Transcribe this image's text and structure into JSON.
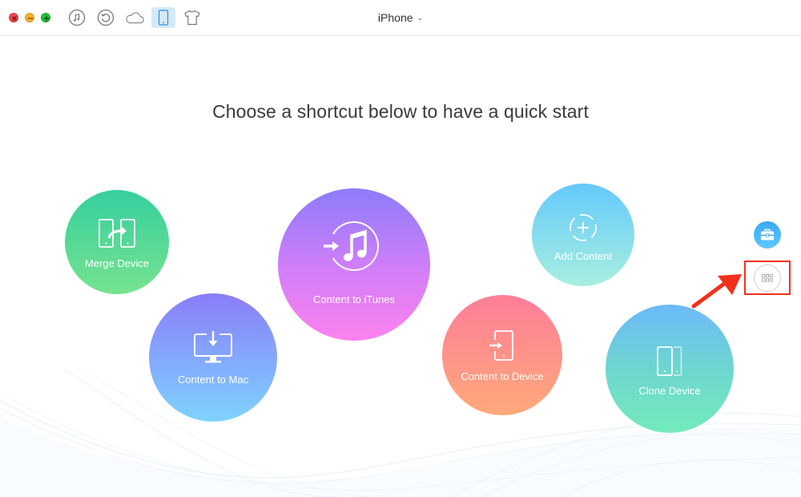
{
  "window": {
    "controls": [
      "close",
      "minimize",
      "maximize"
    ],
    "toolbar": [
      {
        "name": "itunes-library",
        "icon": "music-note-icon",
        "active": false
      },
      {
        "name": "backup-restore",
        "icon": "restore-icon",
        "active": false
      },
      {
        "name": "icloud",
        "icon": "cloud-icon",
        "active": false
      },
      {
        "name": "device",
        "icon": "phone-icon",
        "active": true
      },
      {
        "name": "extras",
        "icon": "tshirt-icon",
        "active": false
      }
    ],
    "device_selector": {
      "label": "iPhone",
      "icon": "chevron-down-icon"
    }
  },
  "main": {
    "headline": "Choose a shortcut below to have a quick start",
    "shortcuts": [
      {
        "id": "merge-device",
        "label": "Merge Device",
        "icon": "merge-device-icon",
        "colors": [
          "#36cf9f",
          "#76e38f"
        ]
      },
      {
        "id": "content-to-mac",
        "label": "Content to Mac",
        "icon": "monitor-download-icon",
        "colors": [
          "#8a7df9",
          "#7ed3ff"
        ]
      },
      {
        "id": "content-to-itunes",
        "label": "Content to iTunes",
        "icon": "itunes-transfer-icon",
        "colors": [
          "#8c7cfb",
          "#fb82ee"
        ]
      },
      {
        "id": "content-to-device",
        "label": "Content to Device",
        "icon": "device-import-icon",
        "colors": [
          "#fd7e98",
          "#ffa97a"
        ]
      },
      {
        "id": "add-content",
        "label": "Add Content",
        "icon": "add-circle-icon",
        "colors": [
          "#64c9fc",
          "#a8efdf"
        ]
      },
      {
        "id": "clone-device",
        "label": "Clone Device",
        "icon": "clone-device-icon",
        "colors": [
          "#6cb9fb",
          "#73ebbb"
        ]
      }
    ]
  },
  "side_tools": [
    {
      "name": "toolkit",
      "icon": "toolbox-icon",
      "color": "#3aa7f5"
    },
    {
      "name": "more",
      "icon": "grid-icon",
      "highlighted": true
    }
  ],
  "annotation": {
    "color": "#f2301b",
    "type": "arrow-and-box"
  }
}
